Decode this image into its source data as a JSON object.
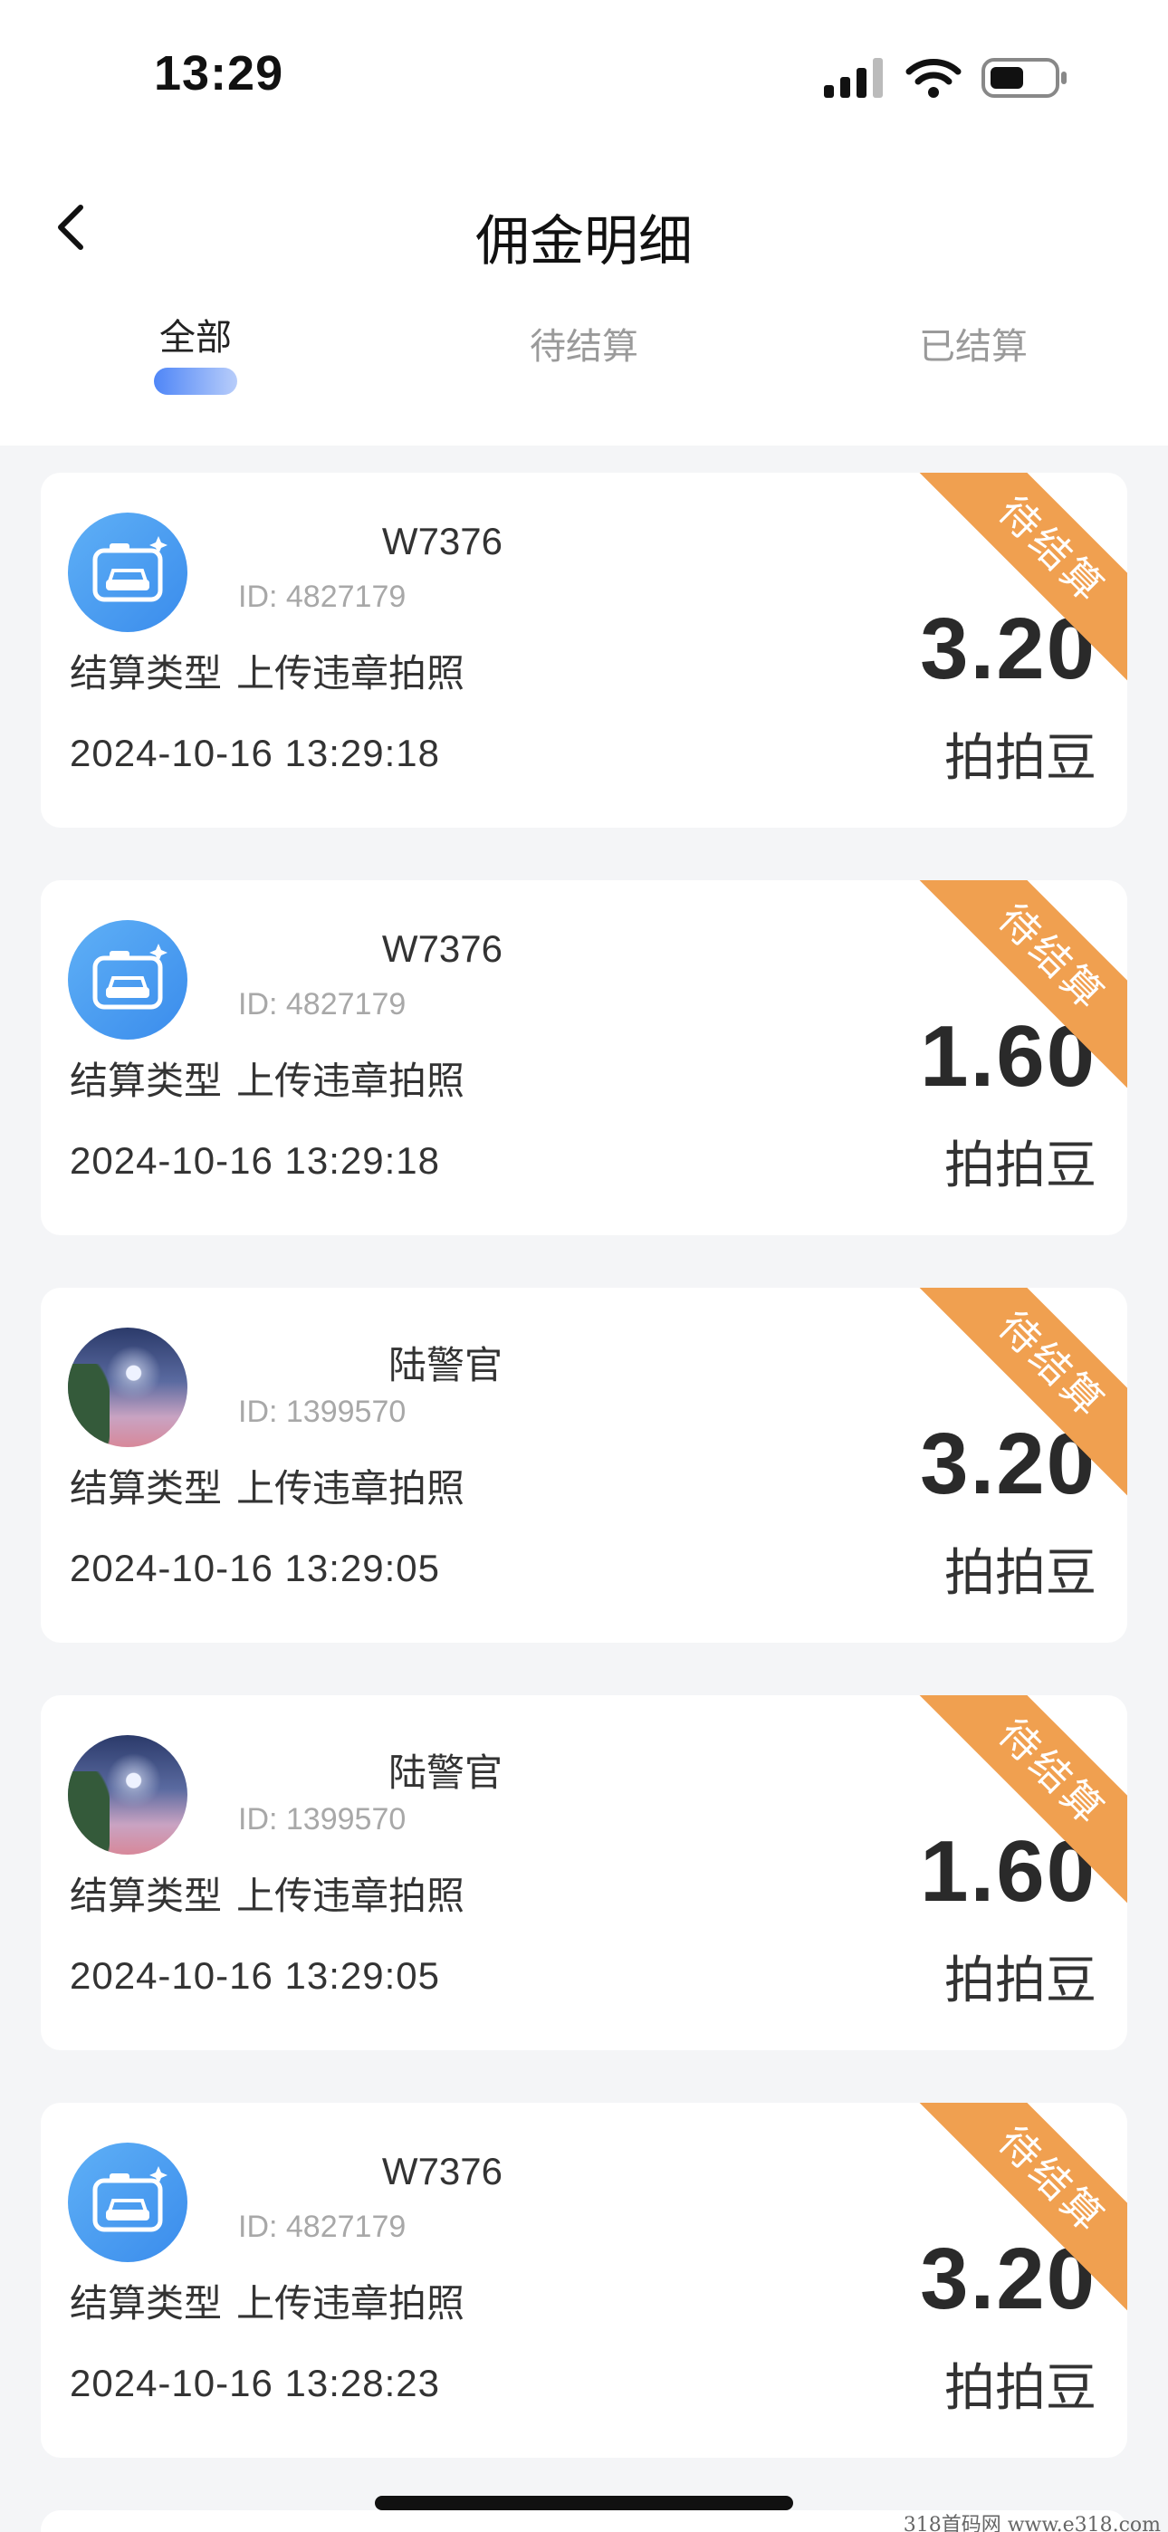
{
  "status_bar": {
    "time": "13:29"
  },
  "nav": {
    "title": "佣金明细"
  },
  "tabs": [
    {
      "label": "全部",
      "active": true
    },
    {
      "label": "待结算",
      "active": false
    },
    {
      "label": "已结算",
      "active": false
    }
  ],
  "colors": {
    "accent": "#4f86f7",
    "ribbon": "#f0a050",
    "background": "#f4f5f7"
  },
  "records": [
    {
      "avatar": "camera-car-icon",
      "name": "W7376",
      "id": "ID: 4827179",
      "settle_label": "结算类型",
      "settle_type": "上传违章拍照",
      "datetime": "2024-10-16 13:29:18",
      "amount": "3.20",
      "unit": "拍拍豆",
      "status": "待结算"
    },
    {
      "avatar": "camera-car-icon",
      "name": "W7376",
      "id": "ID: 4827179",
      "settle_label": "结算类型",
      "settle_type": "上传违章拍照",
      "datetime": "2024-10-16 13:29:18",
      "amount": "1.60",
      "unit": "拍拍豆",
      "status": "待结算"
    },
    {
      "avatar": "photo",
      "name": "陆警官",
      "id": "ID: 1399570",
      "settle_label": "结算类型",
      "settle_type": "上传违章拍照",
      "datetime": "2024-10-16 13:29:05",
      "amount": "3.20",
      "unit": "拍拍豆",
      "status": "待结算"
    },
    {
      "avatar": "photo",
      "name": "陆警官",
      "id": "ID: 1399570",
      "settle_label": "结算类型",
      "settle_type": "上传违章拍照",
      "datetime": "2024-10-16 13:29:05",
      "amount": "1.60",
      "unit": "拍拍豆",
      "status": "待结算"
    },
    {
      "avatar": "camera-car-icon",
      "name": "W7376",
      "id": "ID: 4827179",
      "settle_label": "结算类型",
      "settle_type": "上传违章拍照",
      "datetime": "2024-10-16 13:28:23",
      "amount": "3.20",
      "unit": "拍拍豆",
      "status": "待结算"
    }
  ],
  "watermark": "318首码网 www.e318.com"
}
